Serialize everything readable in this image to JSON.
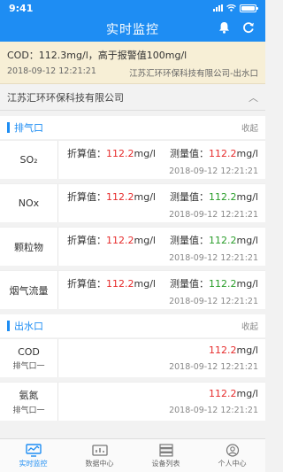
{
  "status": {
    "time": "9:41"
  },
  "navbar": {
    "title": "实时监控"
  },
  "alert": {
    "message": "COD：112.3mg/l，高于报警值100mg/l",
    "time": "2018-09-12  12:21:21",
    "source": "江苏汇环环保科技有限公司-出水口"
  },
  "company": {
    "name": "江苏汇环环保科技有限公司"
  },
  "sections": [
    {
      "title": "排气口",
      "collapse": "收起"
    },
    {
      "title": "出水口",
      "collapse": "收起"
    }
  ],
  "exhaust_rows": [
    {
      "name": "SO₂",
      "conv_label": "折算值：",
      "conv_value": "112.2",
      "conv_unit": "mg/l",
      "meas_label": "测量值：",
      "meas_value": "112.2",
      "meas_unit": "mg/l",
      "time": "2018-09-12  12:21:21"
    },
    {
      "name": "NOx",
      "conv_label": "折算值：",
      "conv_value": "112.2",
      "conv_unit": "mg/l",
      "meas_label": "测量值：",
      "meas_value": "112.2",
      "meas_unit": "mg/l",
      "time": "2018-09-12  12:21:21"
    },
    {
      "name": "颗粒物",
      "conv_label": "折算值：",
      "conv_value": "112.2",
      "conv_unit": "mg/l",
      "meas_label": "测量值：",
      "meas_value": "112.2",
      "meas_unit": "mg/l",
      "time": "2018-09-12  12:21:21"
    },
    {
      "name": "烟气流量",
      "conv_label": "折算值：",
      "conv_value": "112.2",
      "conv_unit": "mg/l",
      "meas_label": "测量值：",
      "meas_value": "112.2",
      "meas_unit": "mg/l",
      "time": "2018-09-12  12:21:21"
    }
  ],
  "outlet_rows": [
    {
      "name": "COD",
      "sub": "排气口一",
      "value": "112.2",
      "unit": "mg/l",
      "time": "2018-09-12  12:21:21"
    },
    {
      "name": "氨氮",
      "sub": "排气口一",
      "value": "112.2",
      "unit": "mg/l",
      "time": "2018-09-12  12:21:21"
    }
  ],
  "tabs": [
    {
      "label": "实时监控",
      "icon": "monitor-icon",
      "active": true
    },
    {
      "label": "数据中心",
      "icon": "data-center-icon",
      "active": false
    },
    {
      "label": "设备列表",
      "icon": "device-list-icon",
      "active": false
    },
    {
      "label": "个人中心",
      "icon": "user-icon",
      "active": false
    }
  ],
  "colors": {
    "primary": "#1e8df3",
    "alarm": "#e62c2c",
    "normal": "#2a9d2a",
    "alert_bg": "#f7efd6"
  }
}
